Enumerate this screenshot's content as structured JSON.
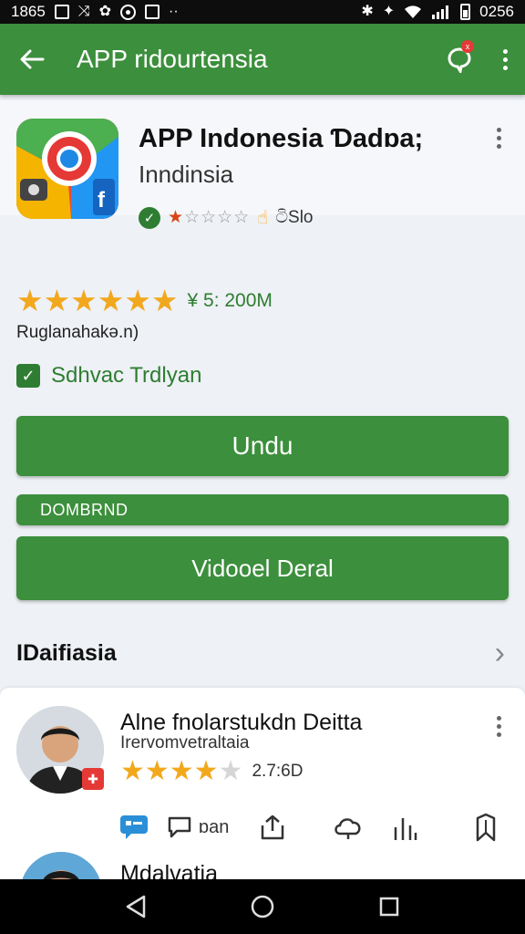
{
  "status_bar": {
    "time_left": "1865",
    "time_right": "0256",
    "icons_left": [
      "photo-icon",
      "shuffle-icon",
      "puzzle-icon",
      "target-icon",
      "square-icon",
      "more-icon"
    ],
    "icons_right": [
      "bluetooth-icon",
      "location-icon",
      "wifi-icon",
      "signal-icon",
      "battery-icon"
    ]
  },
  "app_bar": {
    "title": "APP ridourtensia",
    "notification_badge": "x",
    "background": "#3c8f3c"
  },
  "app_header": {
    "name": "APP Indonesia Ɗadɒa;",
    "subtitle": "Inndinsia",
    "rating_stars": 1,
    "rating_text": "ටිSlo",
    "icon_name": "app-icon"
  },
  "rating": {
    "stars": 6,
    "value_text": "¥ 5: 200M",
    "subtitle": "Ruglanahakə.n)"
  },
  "checkbox": {
    "label": "Sdhvac Trdlyan",
    "checked": true
  },
  "buttons": {
    "primary": "Undu",
    "thin": "DOMBRND",
    "secondary": "Vidooel Deral"
  },
  "section": {
    "title": "IDaifiasia"
  },
  "review": {
    "name": "Alne fnolarstukdn Deitta",
    "subtitle": "Irervomvetraltaia",
    "stars": 4,
    "max_stars": 5,
    "count": "2.7:6D",
    "actions": [
      {
        "icon": "comment-icon",
        "label": ""
      },
      {
        "icon": "chat-bubble-icon",
        "label": "ɒan"
      },
      {
        "icon": "share-icon",
        "label": ""
      },
      {
        "icon": "cloud-icon",
        "label": ""
      },
      {
        "icon": "chart-icon",
        "label": ""
      },
      {
        "icon": "bookmark-icon",
        "label": ""
      }
    ]
  },
  "review2": {
    "name": "Mdalvatia"
  },
  "accent": "#2e7d32",
  "star_color": "#f2a81d"
}
